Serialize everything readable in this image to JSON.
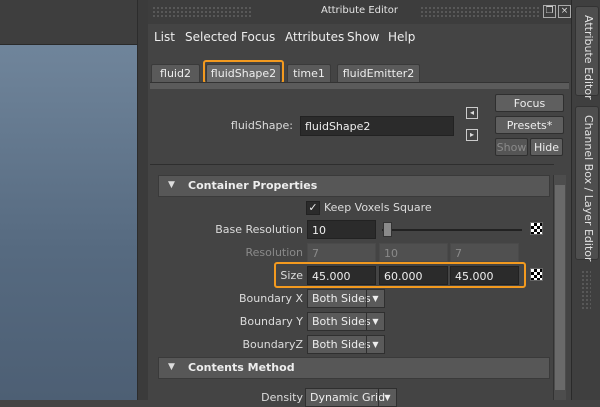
{
  "window": {
    "title": "Attribute Editor"
  },
  "menu": [
    "List",
    "Selected",
    "Focus",
    "Attributes",
    "Show",
    "Help"
  ],
  "tabs": [
    "fluid2",
    "fluidShape2",
    "time1",
    "fluidEmitter2"
  ],
  "active_tab": "fluidShape2",
  "node": {
    "label": "fluidShape:",
    "value": "fluidShape2"
  },
  "buttons": {
    "focus": "Focus",
    "presets": "Presets*",
    "show": "Show",
    "hide": "Hide"
  },
  "sections": {
    "container": "Container Properties",
    "contents": "Contents Method"
  },
  "keep_voxels": {
    "label": "Keep Voxels Square",
    "checked": "✓"
  },
  "base_resolution": {
    "label": "Base Resolution",
    "value": "10"
  },
  "resolution": {
    "label": "Resolution",
    "values": [
      "7",
      "10",
      "7"
    ]
  },
  "size": {
    "label": "Size",
    "values": [
      "45.000",
      "60.000",
      "45.000"
    ]
  },
  "boundaries": [
    {
      "label": "Boundary X",
      "value": "Both Sides"
    },
    {
      "label": "Boundary Y",
      "value": "Both Sides"
    },
    {
      "label": "BoundaryZ",
      "value": "Both Sides"
    }
  ],
  "density": {
    "label": "Density",
    "value": "Dynamic Grid"
  },
  "side_tabs": {
    "attribute_editor": "Attribute Editor",
    "channel_box": "Channel Box / Layer Editor"
  },
  "colors": {
    "highlight": "#f39a1f",
    "panel": "#444444"
  }
}
